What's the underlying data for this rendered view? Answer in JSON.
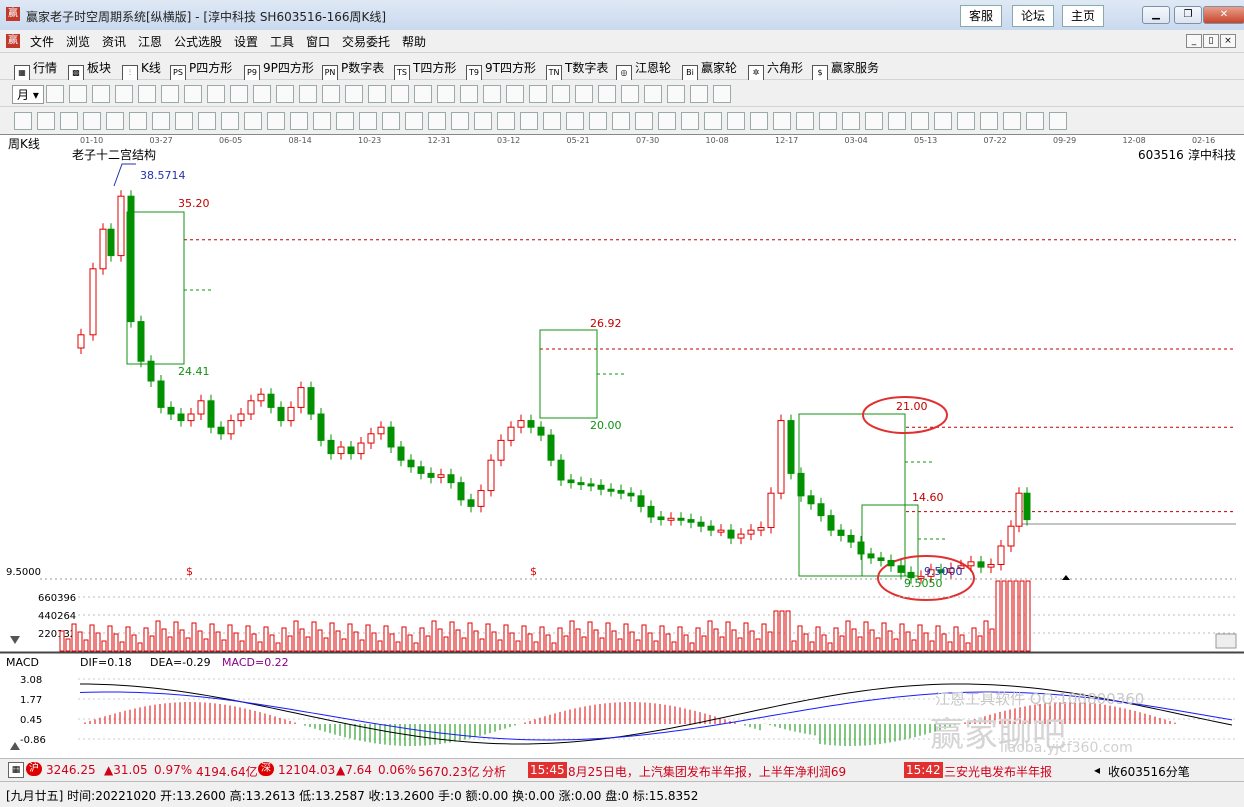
{
  "window": {
    "title": "赢家老子时空周期系统[纵横版] - [淳中科技  SH603516-166周K线]",
    "nav_buttons": [
      "客服",
      "论坛",
      "主页"
    ],
    "controls": {
      "minimize": "▁",
      "restore": "❐",
      "close": "✕"
    }
  },
  "menu": {
    "items": [
      "文件",
      "浏览",
      "资讯",
      "江恩",
      "公式选股",
      "设置",
      "工具",
      "窗口",
      "交易委托",
      "帮助"
    ],
    "mdi": [
      "_",
      "▯",
      "×"
    ]
  },
  "toolbar1": {
    "items": [
      "行情",
      "板块",
      "K线",
      "P四方形",
      "9P四方形",
      "P数字表",
      "T四方形",
      "9T四方形",
      "T数字表",
      "江恩轮",
      "赢家轮",
      "六角形",
      "赢家服务"
    ],
    "icons": [
      "grid-icon",
      "blocks-icon",
      "kline-icon",
      "ps-icon",
      "p9-icon",
      "pn-icon",
      "ts-icon",
      "t9-icon",
      "tn-icon",
      "gann-wheel-icon",
      "winner-wheel-icon",
      "hexagon-icon",
      "dollar-icon"
    ],
    "icon_glyphs": [
      "▦",
      "▩",
      "⫶",
      "PS",
      "P9",
      "PN",
      "TS",
      "T9",
      "TN",
      "◎",
      "Bi",
      "✲",
      "$"
    ]
  },
  "toolbar2": {
    "period_label": "月"
  },
  "chart": {
    "period_label": "周K线",
    "indicator_title": "老子十二宫结构",
    "stock_code": "603516",
    "stock_name": "淳中科技",
    "date_ticks": [
      "01-10",
      "03-27",
      "06-05",
      "08-14",
      "10-23",
      "12-31",
      "03-12",
      "05-21",
      "07-30",
      "10-08",
      "12-17",
      "03-04",
      "05-13",
      "07-22",
      "09-29",
      "12-08",
      "02-16"
    ],
    "price_labels": {
      "high": "38.5714",
      "level1": "35.20",
      "low1": "24.41",
      "level2": "26.92",
      "low2": "20.00",
      "level3": "21.00",
      "level4": "14.60",
      "low3": "9.5000",
      "low3b": "9.5050",
      "left_axis": "9.5000"
    },
    "volume_ticks": [
      "660396",
      "440264",
      "220132"
    ],
    "dollar_marks": [
      "$",
      "$"
    ],
    "colors": {
      "up": "#e00000",
      "down": "#009000",
      "level_line": "#c00000",
      "ellipse": "#e03030",
      "box": "#109010"
    }
  },
  "macd": {
    "label": "MACD",
    "dif": "DIF=0.18",
    "dea": "DEA=-0.29",
    "macd": "MACD=0.22",
    "ticks": [
      "3.08",
      "1.77",
      "0.45",
      "-0.86"
    ],
    "watermark": "江恩工具软件  QQ:100800360",
    "watermark2": "赢家聊吧",
    "watermark_url": "liaoba.yjcf360.com"
  },
  "status": {
    "sh_index": "3246.25",
    "sh_change": "▲31.05",
    "sh_pct": "0.97%",
    "sh_amount": "4194.64亿",
    "sz_index": "12104.03",
    "sz_change": "▲7.64",
    "sz_pct": "0.06%",
    "sz_amount": "5670.23亿",
    "analysis": "分析",
    "news1_time": "15:45",
    "news1_text": "8月25日电，上汽集团发布半年报，上半年净利润69",
    "news2_time": "15:42",
    "news2_text": "三安光电发布半年报",
    "right_text": "收603516分笔"
  },
  "info": {
    "text": "[九月廿五] 时间:20221020 开:13.2600 高:13.2613 低:13.2587 收:13.2600 手:0 额:0.00 换:0.00 涨:0.00 盘:0 标:15.8352"
  }
}
